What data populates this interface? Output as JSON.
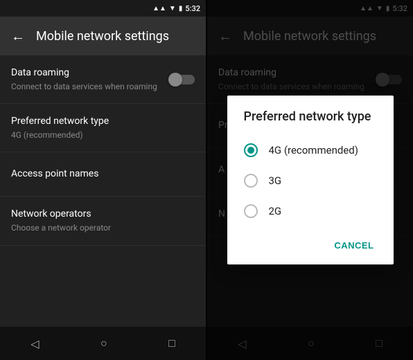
{
  "left_screen": {
    "status_bar": {
      "time": "5:32"
    },
    "top_bar": {
      "title": "Mobile network settings",
      "back_label": "←"
    },
    "settings": [
      {
        "id": "data-roaming",
        "title": "Data roaming",
        "subtitle": "Connect to data services when roaming",
        "has_toggle": true,
        "toggle_on": false
      },
      {
        "id": "preferred-network",
        "title": "Preferred network type",
        "subtitle": "4G (recommended)",
        "has_toggle": false
      },
      {
        "id": "access-point",
        "title": "Access point names",
        "subtitle": "",
        "has_toggle": false
      },
      {
        "id": "network-operators",
        "title": "Network operators",
        "subtitle": "Choose a network operator",
        "has_toggle": false
      }
    ],
    "nav": {
      "back": "◁",
      "home": "○",
      "recents": "□"
    }
  },
  "right_screen": {
    "status_bar": {
      "time": "5:32"
    },
    "top_bar": {
      "title": "Mobile network settings",
      "back_label": "←"
    },
    "settings": [
      {
        "id": "data-roaming-r",
        "title": "Data roaming",
        "subtitle": "Connect to data services when roaming",
        "has_toggle": true,
        "toggle_on": false
      },
      {
        "id": "preferred-network-r",
        "title": "Pr",
        "subtitle": "",
        "has_toggle": false
      },
      {
        "id": "access-point-r",
        "title": "A",
        "subtitle": "",
        "has_toggle": false
      },
      {
        "id": "network-operators-r",
        "title": "N",
        "subtitle": "",
        "has_toggle": false
      }
    ],
    "nav": {
      "back": "◁",
      "home": "○",
      "recents": "□"
    },
    "dialog": {
      "title": "Preferred network type",
      "options": [
        {
          "label": "4G (recommended)",
          "selected": true
        },
        {
          "label": "3G",
          "selected": false
        },
        {
          "label": "2G",
          "selected": false
        }
      ],
      "cancel_label": "CANCEL"
    }
  }
}
